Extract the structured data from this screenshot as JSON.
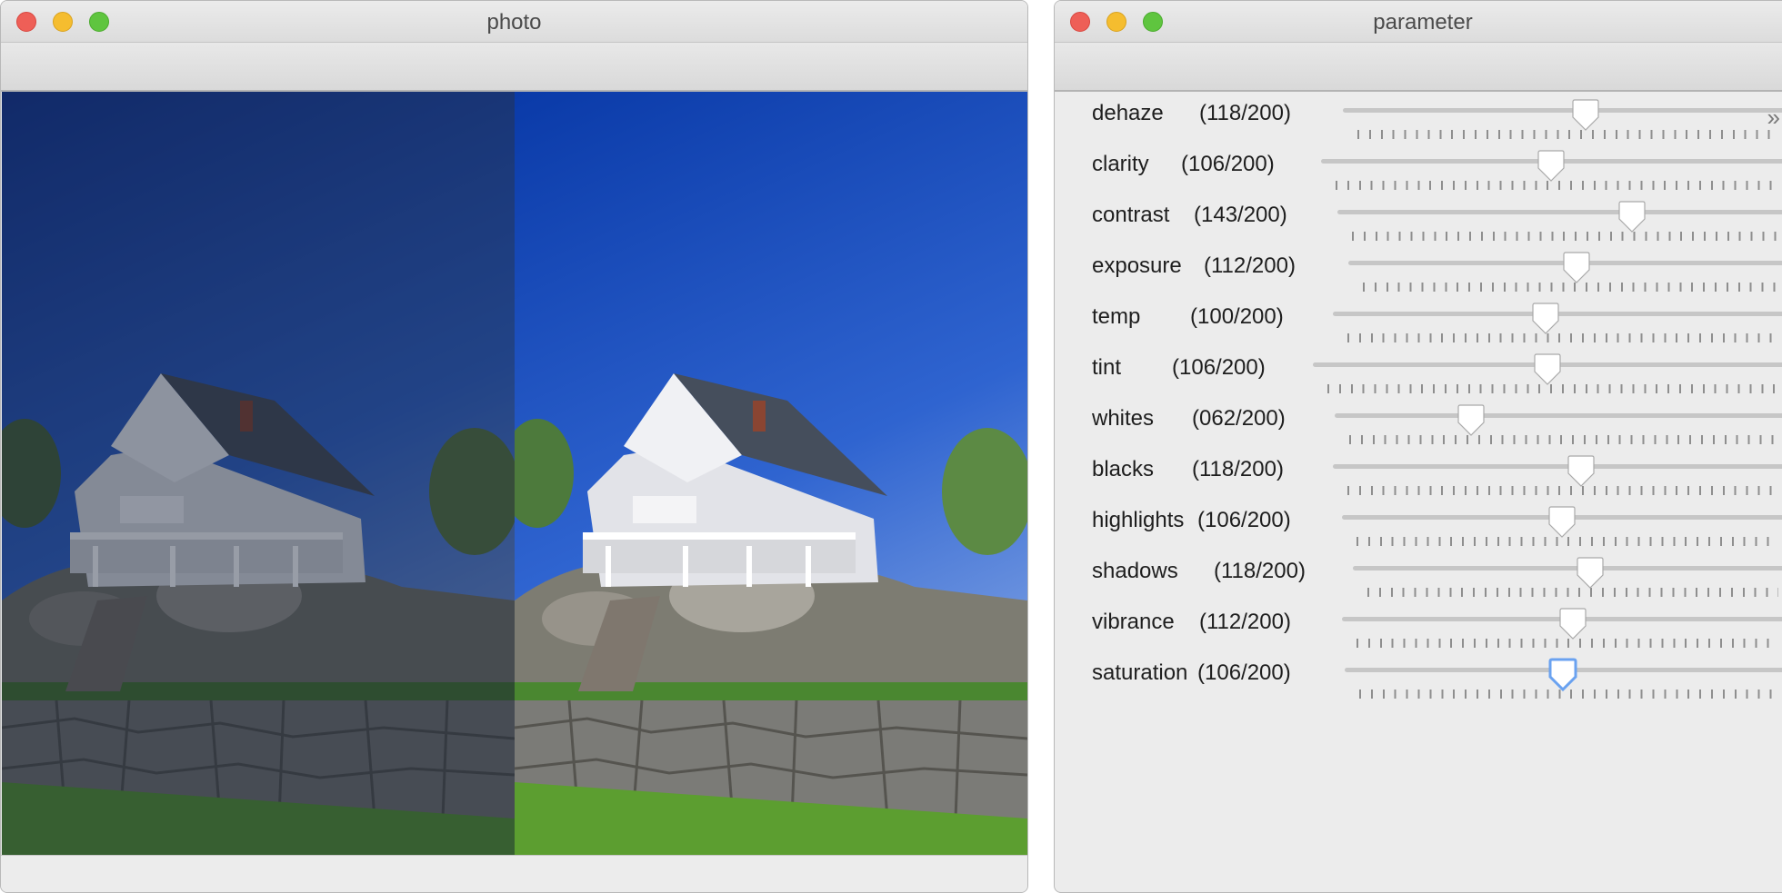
{
  "photo_window": {
    "title": "photo",
    "image_description_icon": "house-photo"
  },
  "parameter_window": {
    "title": "parameter",
    "expand_icon": "double-chevron-right-icon",
    "parameters": [
      {
        "name": "dehaze",
        "display": "(118/200)",
        "value": 118,
        "max": 200
      },
      {
        "name": "clarity",
        "display": "(106/200)",
        "value": 106,
        "max": 200
      },
      {
        "name": "contrast",
        "display": "(143/200)",
        "value": 143,
        "max": 200
      },
      {
        "name": "exposure",
        "display": "(112/200)",
        "value": 112,
        "max": 200
      },
      {
        "name": "temp",
        "display": "(100/200)",
        "value": 100,
        "max": 200
      },
      {
        "name": "tint",
        "display": "(106/200)",
        "value": 106,
        "max": 200
      },
      {
        "name": "whites",
        "display": "(062/200)",
        "value": 62,
        "max": 200
      },
      {
        "name": "blacks",
        "display": "(118/200)",
        "value": 118,
        "max": 200
      },
      {
        "name": "highlights",
        "display": "(106/200)",
        "value": 106,
        "max": 200
      },
      {
        "name": "shadows",
        "display": "(118/200)",
        "value": 118,
        "max": 200
      },
      {
        "name": "vibrance",
        "display": "(112/200)",
        "value": 112,
        "max": 200
      },
      {
        "name": "saturation",
        "display": "(106/200)",
        "value": 106,
        "max": 200,
        "focused": true
      }
    ]
  },
  "colors": {
    "close": "#ee5f57",
    "minimize": "#f5bd2f",
    "maximize": "#5fc53f",
    "focus": "#6aa2f0"
  }
}
